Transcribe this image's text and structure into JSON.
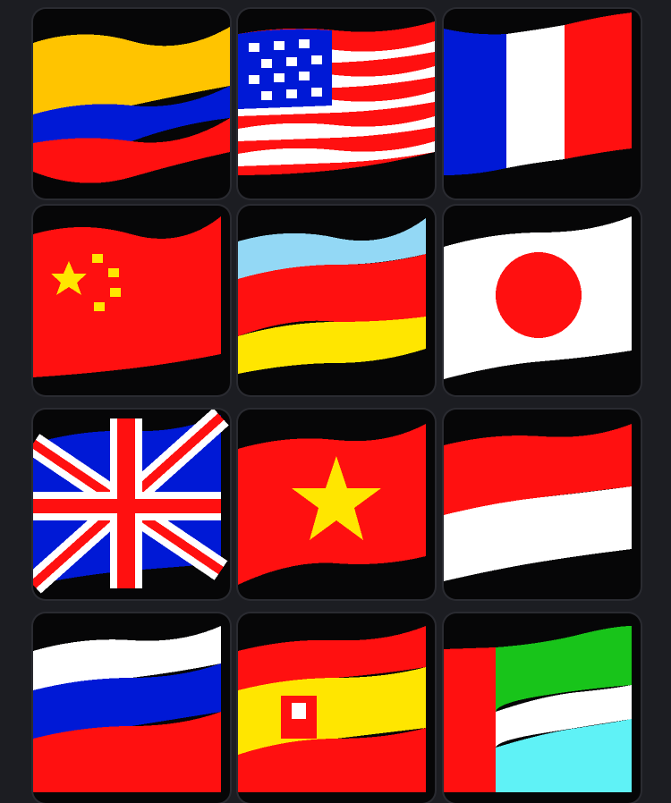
{
  "flag_grid": {
    "items": [
      {
        "icon": "colombia-flag-icon"
      },
      {
        "icon": "usa-flag-icon"
      },
      {
        "icon": "france-flag-icon"
      },
      {
        "icon": "china-flag-icon"
      },
      {
        "icon": "argentina-germany-flag-icon"
      },
      {
        "icon": "japan-flag-icon"
      },
      {
        "icon": "uk-flag-icon"
      },
      {
        "icon": "vietnam-flag-icon"
      },
      {
        "icon": "indonesia-flag-icon"
      },
      {
        "icon": "russia-flag-icon"
      },
      {
        "icon": "spain-flag-icon"
      },
      {
        "icon": "sierra-leone-flag-icon"
      }
    ]
  },
  "colors": {
    "background": "#1c1d22",
    "tile": "#060607",
    "red": "#ff1010",
    "yellow": "#ffe600",
    "gold": "#ffc400",
    "blue": "#0019d6",
    "white": "#ffffff",
    "light_blue": "#93d8f5",
    "green": "#18c41a",
    "cyan": "#5ff2f6"
  }
}
